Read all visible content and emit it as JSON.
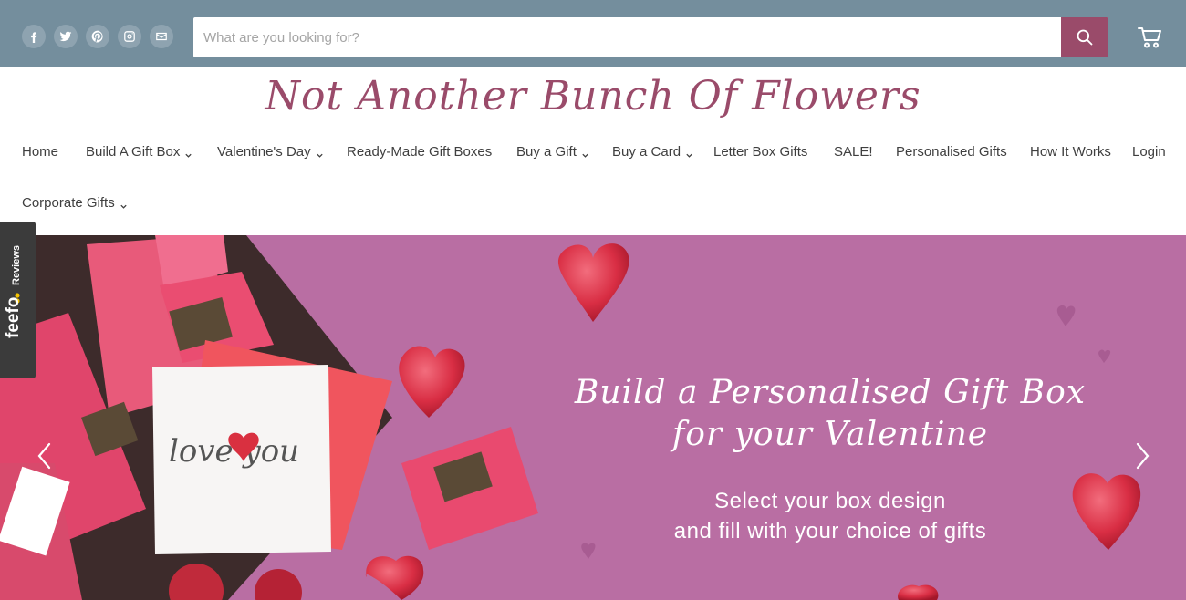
{
  "header": {
    "social": [
      {
        "icon": "facebook-icon"
      },
      {
        "icon": "twitter-icon"
      },
      {
        "icon": "pinterest-icon"
      },
      {
        "icon": "instagram-icon"
      },
      {
        "icon": "email-icon"
      }
    ],
    "search": {
      "placeholder": "What are you looking for?"
    },
    "search_icon": "search-icon",
    "cart_icon": "cart-icon",
    "colors": {
      "topbar": "#748e9d",
      "accent": "#9a4b6a"
    }
  },
  "logo": {
    "text": "Not Another Bunch Of Flowers"
  },
  "nav": {
    "items": [
      {
        "label": "Home",
        "dropdown": false
      },
      {
        "label": "Build A Gift Box",
        "dropdown": true
      },
      {
        "label": "Valentine's Day",
        "dropdown": true
      },
      {
        "label": "Ready-Made Gift Boxes",
        "dropdown": false
      },
      {
        "label": "Buy a Gift",
        "dropdown": true
      },
      {
        "label": "Buy a Card",
        "dropdown": true
      },
      {
        "label": "Letter Box Gifts",
        "dropdown": false
      },
      {
        "label": "SALE!",
        "dropdown": false
      },
      {
        "label": "Personalised Gifts",
        "dropdown": false
      },
      {
        "label": "How It Works",
        "dropdown": false
      },
      {
        "label": "Login",
        "dropdown": false
      },
      {
        "label": "Corporate Gifts",
        "dropdown": true
      }
    ]
  },
  "hero": {
    "title_line1": "Build a Personalised Gift Box",
    "title_line2": "for your Valentine",
    "sub_line1": "Select your box design",
    "sub_line2": "and fill with your choice of gifts",
    "card_text": "love you",
    "prev_icon": "chevron-left-icon",
    "next_icon": "chevron-right-icon",
    "background": "#b96ea3"
  },
  "feefo": {
    "brand": "feefo",
    "label": "Reviews"
  }
}
